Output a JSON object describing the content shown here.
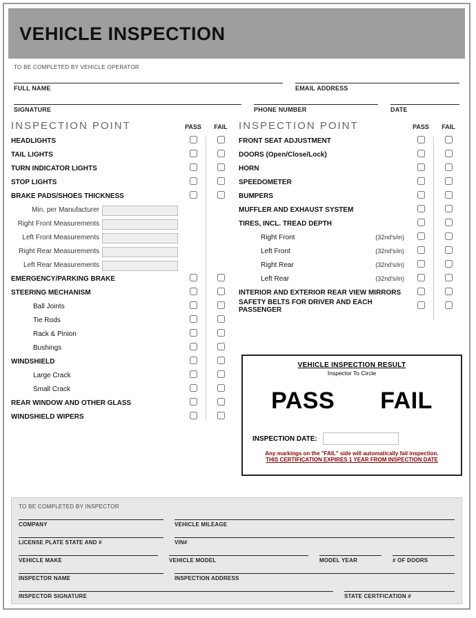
{
  "header": {
    "title": "VEHICLE INSPECTION"
  },
  "operator": {
    "note": "TO BE COMPLETED BY VEHICLE OPERATOR",
    "full_name": "FULL NAME",
    "email": "EMAIL ADDRESS",
    "signature": "SIGNATURE",
    "phone": "PHONE NUMBER",
    "date": "DATE"
  },
  "checklist": {
    "heading": "INSPECTION POINT",
    "pass": "PASS",
    "fail": "FAIL",
    "left": {
      "items": [
        "HEADLIGHTS",
        "TAIL LIGHTS",
        "TURN INDICATOR LIGHTS",
        "STOP LIGHTS",
        "BRAKE PADS/SHOES THICKNESS"
      ],
      "measurements": [
        "Min. per Manufacturer",
        "Right Front Measurements",
        "Left Front Measurements",
        "Right Rear Measurements",
        "Left Rear Measurements"
      ],
      "items2": [
        "EMERGENCY/PARKING BRAKE",
        "STEERING MECHANISM"
      ],
      "steering_sub": [
        "Ball Joints",
        "Tie Rods",
        "Rack & Pinion",
        "Bushings"
      ],
      "items3": [
        "WINDSHIELD"
      ],
      "windshield_sub": [
        "Large Crack",
        "Small Crack"
      ],
      "items4": [
        "REAR WINDOW AND OTHER GLASS",
        "WINDSHIELD WIPERS"
      ]
    },
    "right": {
      "items": [
        "FRONT SEAT ADJUSTMENT",
        "DOORS (Open/Close/Lock)",
        "HORN",
        "SPEEDOMETER",
        "BUMPERS",
        "MUFFLER AND EXHAUST SYSTEM",
        "TIRES, INCL. TREAD DEPTH"
      ],
      "tires_sub": [
        {
          "label": "Right Front",
          "unit": "(32nd's/in)"
        },
        {
          "label": "Left Front",
          "unit": "(32nd's/in)"
        },
        {
          "label": "Right Rear",
          "unit": "(32nd's/in)"
        },
        {
          "label": "Left Rear",
          "unit": "(32nd's/in)"
        }
      ],
      "items2": [
        "INTERIOR AND EXTERIOR REAR VIEW MIRRORS",
        "SAFETY BELTS FOR DRIVER AND EACH PASSENGER"
      ]
    }
  },
  "result": {
    "title": "VEHICLE INSPECTION RESULT",
    "sub": "Inspector To Circle",
    "pass": "PASS",
    "fail": "FAIL",
    "date_label": "INSPECTION DATE:",
    "warn1": "Any markings on the \"FAIL\" side will automatically fail inspection.",
    "warn2": "THIS CERTIFICATION EXPIRES 1 YEAR FROM INSPECTION DATE"
  },
  "inspector": {
    "note": "TO BE COMPLETED BY INSPECTOR",
    "company": "COMPANY",
    "mileage": "VEHICLE MILEAGE",
    "plate": "LICENSE PLATE STATE AND #",
    "vin": "VIN#",
    "make": "VEHICLE MAKE",
    "model": "VEHICLE MODEL",
    "year": "MODEL YEAR",
    "doors": "# OF DOORS",
    "iname": "INSPECTOR NAME",
    "iaddr": "INSPECTION ADDRESS",
    "isig": "INSPECTOR SIGNATURE",
    "cert": "STATE CERTFICATION #"
  }
}
